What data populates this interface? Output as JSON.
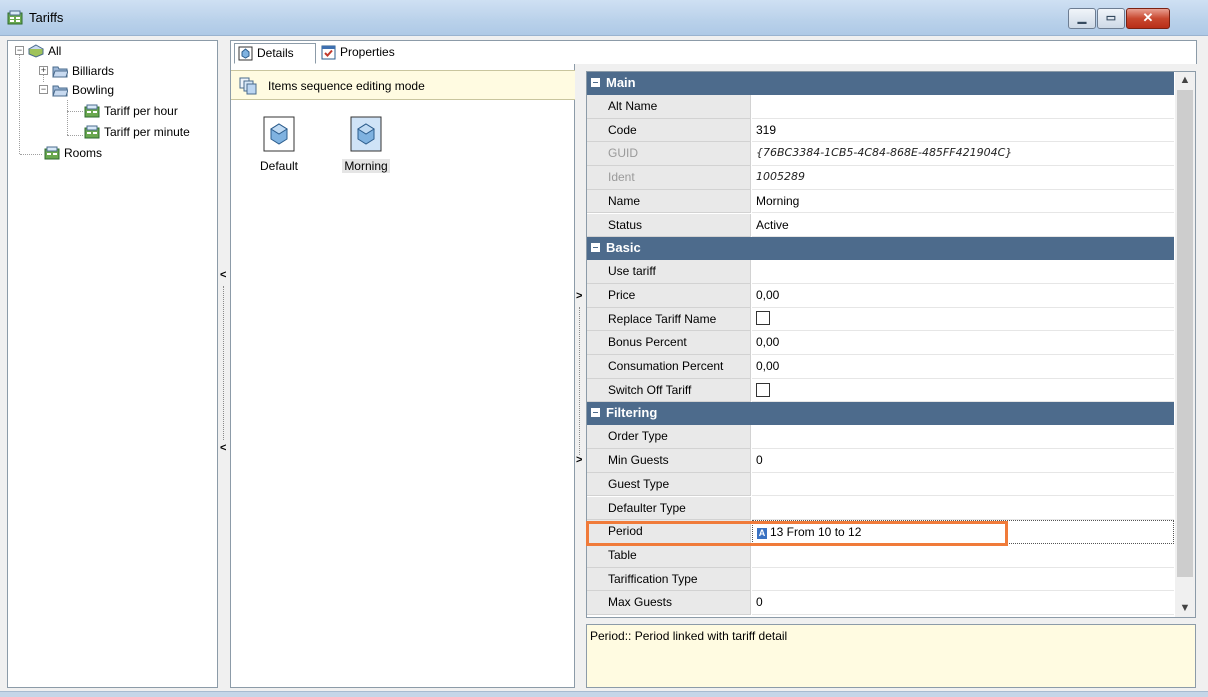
{
  "window": {
    "title": "Tariffs"
  },
  "tree": {
    "items": [
      {
        "label": "All"
      },
      {
        "label": "Billiards"
      },
      {
        "label": "Bowling"
      },
      {
        "label": "Tariff per hour"
      },
      {
        "label": "Tariff per minute"
      },
      {
        "label": "Rooms"
      }
    ]
  },
  "tabs": [
    {
      "label": "Details",
      "active": true
    },
    {
      "label": "Properties",
      "active": false
    }
  ],
  "mode_bar": {
    "text": "Items sequence editing mode"
  },
  "items": [
    {
      "label": "Default",
      "selected": false
    },
    {
      "label": "Morning",
      "selected": true
    }
  ],
  "property_grid": {
    "categories": {
      "main": "Main",
      "basic": "Basic",
      "filtering": "Filtering"
    },
    "main": [
      {
        "name": "Alt Name",
        "value": ""
      },
      {
        "name": "Code",
        "value": "319"
      },
      {
        "name": "GUID",
        "value": "{76BC3384-1CB5-4C84-868E-485FF421904C}"
      },
      {
        "name": "Ident",
        "value": "1005289"
      },
      {
        "name": "Name",
        "value": "Morning"
      },
      {
        "name": "Status",
        "value": "Active"
      }
    ],
    "basic": [
      {
        "name": "Use tariff",
        "value": ""
      },
      {
        "name": "Price",
        "value": "0,00"
      },
      {
        "name": "Replace Tariff Name",
        "value": ""
      },
      {
        "name": "Bonus Percent",
        "value": "0,00"
      },
      {
        "name": "Consumation Percent",
        "value": "0,00"
      },
      {
        "name": "Switch Off Tariff",
        "value": ""
      }
    ],
    "filtering": [
      {
        "name": "Order Type",
        "value": ""
      },
      {
        "name": "Min Guests",
        "value": "0"
      },
      {
        "name": "Guest Type",
        "value": ""
      },
      {
        "name": "Defaulter Type",
        "value": ""
      },
      {
        "name": "Period",
        "value": "13 From 10 to 12",
        "badge": "A"
      },
      {
        "name": "Table",
        "value": ""
      },
      {
        "name": "Tariffication Type",
        "value": ""
      },
      {
        "name": "Max Guests",
        "value": "0"
      }
    ]
  },
  "description": {
    "text": "Period:: Period linked with tariff detail"
  },
  "colors": {
    "category_header": "#4d6b8c",
    "highlight": "#f07b3a",
    "mode_bar_bg": "#fffbe1"
  }
}
